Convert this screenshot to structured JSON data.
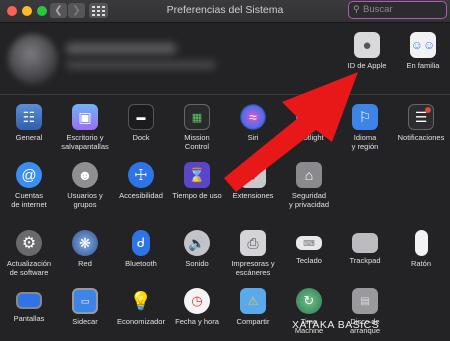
{
  "window": {
    "title": "Preferencias del Sistema"
  },
  "search": {
    "placeholder": "Buscar",
    "value": ""
  },
  "account": [
    {
      "label": "ID de Apple",
      "icon": "apple-logo-icon"
    },
    {
      "label": "En familia",
      "icon": "family-icon"
    }
  ],
  "rows": [
    [
      {
        "label": "General",
        "icon": "general-icon"
      },
      {
        "label": "Escritorio y\nsalvapantallas",
        "icon": "desktop-icon"
      },
      {
        "label": "Dock",
        "icon": "dock-icon"
      },
      {
        "label": "Mission\nControl",
        "icon": "mission-control-icon"
      },
      {
        "label": "Siri",
        "icon": "siri-icon"
      },
      {
        "label": "Spotlight",
        "icon": "spotlight-icon"
      },
      {
        "label": "Idioma\ny región",
        "icon": "language-globe-icon"
      },
      {
        "label": "Notificaciones",
        "icon": "notifications-icon"
      }
    ],
    [
      {
        "label": "Cuentas\nde internet",
        "icon": "at-sign-icon"
      },
      {
        "label": "Usuarios y\ngrupos",
        "icon": "users-icon"
      },
      {
        "label": "Accesibilidad",
        "icon": "accessibility-icon"
      },
      {
        "label": "Tiempo de uso",
        "icon": "hourglass-icon"
      },
      {
        "label": "Extensiones",
        "icon": "puzzle-icon"
      },
      {
        "label": "Seguridad\ny privacidad",
        "icon": "house-security-icon"
      }
    ],
    [
      {
        "label": "Actualización\nde software",
        "icon": "gear-update-icon"
      },
      {
        "label": "Red",
        "icon": "network-globe-icon"
      },
      {
        "label": "Bluetooth",
        "icon": "bluetooth-icon"
      },
      {
        "label": "Sonido",
        "icon": "speaker-icon"
      },
      {
        "label": "Impresoras y\nescáneres",
        "icon": "printer-icon"
      },
      {
        "label": "Teclado",
        "icon": "keyboard-icon"
      },
      {
        "label": "Trackpad",
        "icon": "trackpad-icon"
      },
      {
        "label": "Ratón",
        "icon": "mouse-icon"
      }
    ],
    [
      {
        "label": "Pantallas",
        "icon": "display-icon"
      },
      {
        "label": "Sidecar",
        "icon": "sidecar-icon"
      },
      {
        "label": "Economizador",
        "icon": "lightbulb-icon"
      },
      {
        "label": "Fecha y hora",
        "icon": "calendar-clock-icon"
      },
      {
        "label": "Compartir",
        "icon": "sharing-folder-icon"
      },
      {
        "label": "Time\nMachine",
        "icon": "time-machine-icon"
      },
      {
        "label": "Disco de\narranque",
        "icon": "startup-disk-icon"
      }
    ]
  ],
  "watermark": "XATAKA BASICS",
  "colors": {
    "accent": "#e81818",
    "search_border": "#b05bb5"
  }
}
